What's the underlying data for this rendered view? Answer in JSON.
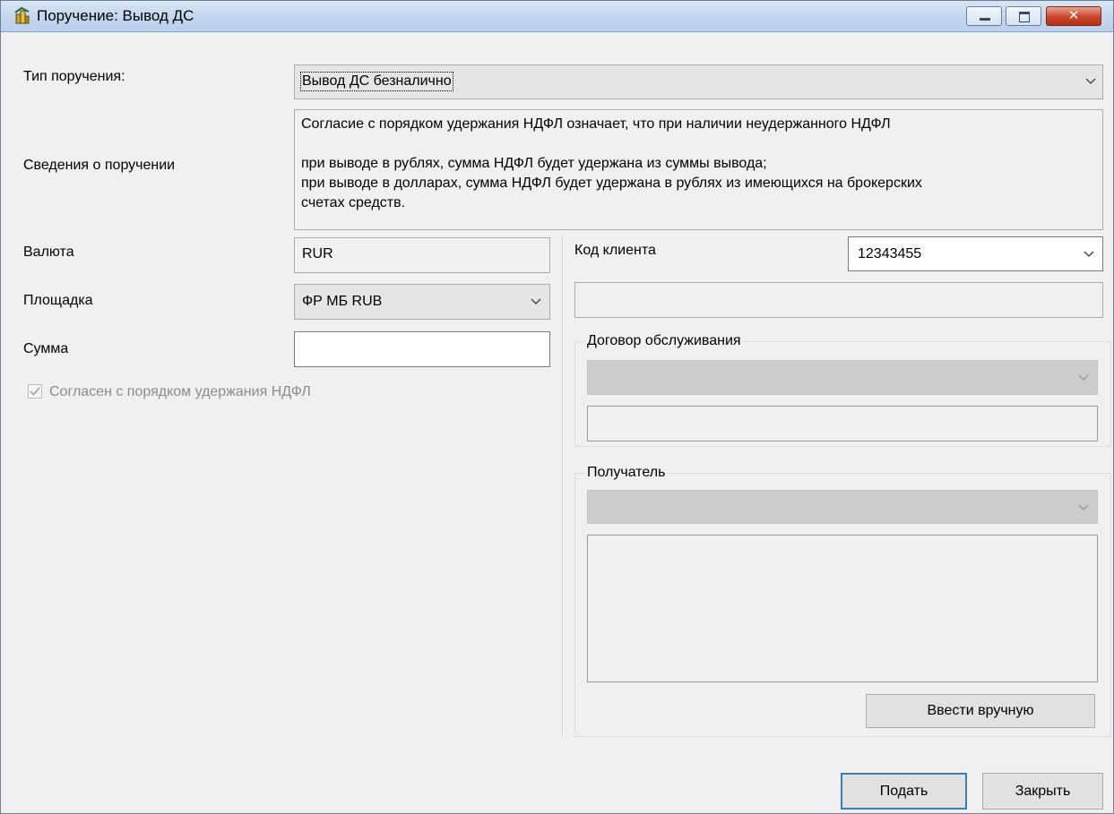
{
  "window": {
    "title": "Поручение: Вывод ДС",
    "buttons": [
      "minimize",
      "maximize",
      "close"
    ]
  },
  "form": {
    "order_type": {
      "label": "Тип поручения:",
      "value": "Вывод ДС безналично"
    },
    "info": {
      "label": "Сведения о поручении",
      "line1": "Согласие с порядком удержания НДФЛ означает, что при наличии неудержанного НДФЛ",
      "line2": "при выводе в рублях, сумма НДФЛ будет удержана из суммы вывода;",
      "line3": "при выводе в долларах, сумма НДФЛ будет удержана в рублях из имеющихся на брокерских",
      "line4": "счетах средств."
    },
    "currency": {
      "label": "Валюта",
      "value": "RUR"
    },
    "platform": {
      "label": "Площадка",
      "value": "ФР МБ RUB"
    },
    "amount": {
      "label": "Сумма",
      "value": ""
    },
    "agree": {
      "label": "Согласен с порядком удержания НДФЛ",
      "checked": true,
      "enabled": false
    },
    "client_code": {
      "label": "Код клиента",
      "value": "12343455",
      "name_value": ""
    },
    "service_contract": {
      "label": "Договор обслуживания",
      "value": "",
      "details": ""
    },
    "recipient": {
      "label": "Получатель",
      "value": "",
      "details": ""
    },
    "manual_button": "Ввести вручную"
  },
  "footer": {
    "submit": "Подать",
    "close": "Закрыть"
  }
}
